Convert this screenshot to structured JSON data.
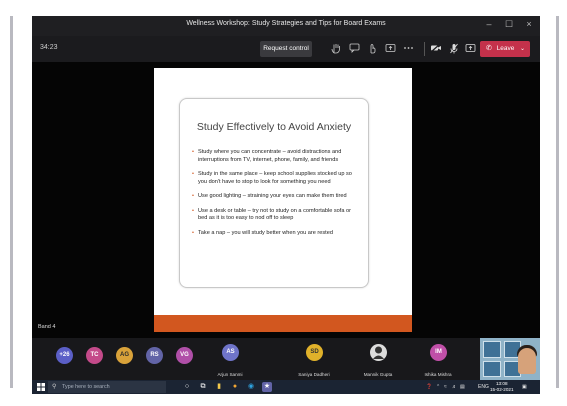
{
  "window": {
    "title": "Wellness Workshop: Study Strategies and Tips for Board Exams",
    "minimize_glyph": "–",
    "maximize_glyph": "☐",
    "close_glyph": "×"
  },
  "toolbar": {
    "timer": "34:23",
    "request_control_label": "Request control",
    "leave_label": "Leave",
    "icons": [
      "hand-icon",
      "chat-icon",
      "reactions-icon",
      "share-icon",
      "more-icon",
      "camera-off-icon",
      "mic-off-icon",
      "share-tray-icon"
    ],
    "colors": {
      "leave": "#c4314b",
      "bar": "#1b1b1e"
    }
  },
  "slide": {
    "title": "Study Effectively to Avoid Anxiety",
    "bullets": [
      "Study where you can concentrate – avoid distractions and interruptions from TV, internet, phone, family, and friends",
      "Study in the same place – keep school supplies stocked up so you don't have to stop to look for something you need",
      "Use good lighting – straining your eyes can make them tired",
      "Use a desk or table – try not to study on a comfortable sofa or bed as it is too easy to nod off to sleep",
      "Take a nap – you will study better when you are rested"
    ],
    "accent_color": "#d2571f"
  },
  "presenter_label": "Band 4",
  "participants": {
    "avatars": [
      {
        "initials": "+26",
        "color": "#5b5fc7"
      },
      {
        "initials": "TC",
        "color": "#c44a8a"
      },
      {
        "initials": "AG",
        "color": "#d9a23a"
      },
      {
        "initials": "RS",
        "color": "#6264a7"
      },
      {
        "initials": "VG",
        "color": "#b04fa8"
      }
    ],
    "named": [
      {
        "initials": "AS",
        "name": "Arjun Sanmi",
        "color": "#6f74c9"
      },
      {
        "initials": "SD",
        "name": "Saniya Dadheri",
        "color": "#e0b12a"
      },
      {
        "initials": "",
        "name": "Mannik Gupta",
        "color": "#dcdcdc"
      },
      {
        "initials": "IM",
        "name": "Ishika Mishra",
        "color": "#c04fa8"
      }
    ]
  },
  "taskbar": {
    "search_placeholder": "Type here to search",
    "language": "ENG",
    "time": "13:08",
    "date": "15-02-2021"
  }
}
